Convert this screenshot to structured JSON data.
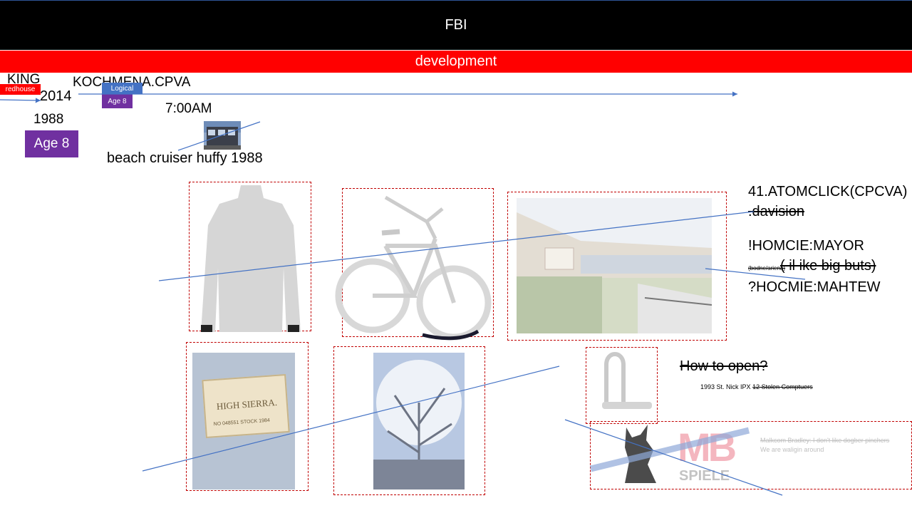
{
  "header": {
    "title": "FBI",
    "subtitle": "development"
  },
  "timeline": {
    "king": "KING",
    "redhouse_tag": "redhouse",
    "year_2014": "2014",
    "year_1988": "1988",
    "age_badge_large": "Age 8",
    "kochmena": "KOCHMENA.CPVA",
    "logical_tag": "Logical",
    "age_badge_small": "Age 8",
    "time": "7:00AM",
    "bike_caption": "beach cruiser huffy 1988"
  },
  "notes": {
    "line1": "41.ATOMCLICK(CPCVA)",
    "line2": ".davision",
    "line3": "!HOMCIE:MAYOR",
    "line4_small": "(bodne/ariena)",
    "line4_big": "( il ike big buts)",
    "line5": "?HOCMIE:MAHTEW",
    "how_to_open": "How to open?",
    "st_nick": "1993 St. Nick IPX",
    "stolen": "12 Stolen Comptuers",
    "malkcom_1": "Malkcom Bradley: I don't like dogber pinchers",
    "malkcom_2": "We are waligin around"
  },
  "images": {
    "jeans_label_brand": "HIGH SIERRA.",
    "jeans_label_number": "NO 048551 STOCK 1984",
    "mb_logo": "MB",
    "mb_logo_sub": "SPIELE"
  },
  "colors": {
    "black_bar": "#000000",
    "red_bar": "#ff0000",
    "purple_badge": "#7030a0",
    "blue_tag": "#4472c4",
    "line_blue": "#4472c4",
    "frame_red": "#c00000"
  }
}
